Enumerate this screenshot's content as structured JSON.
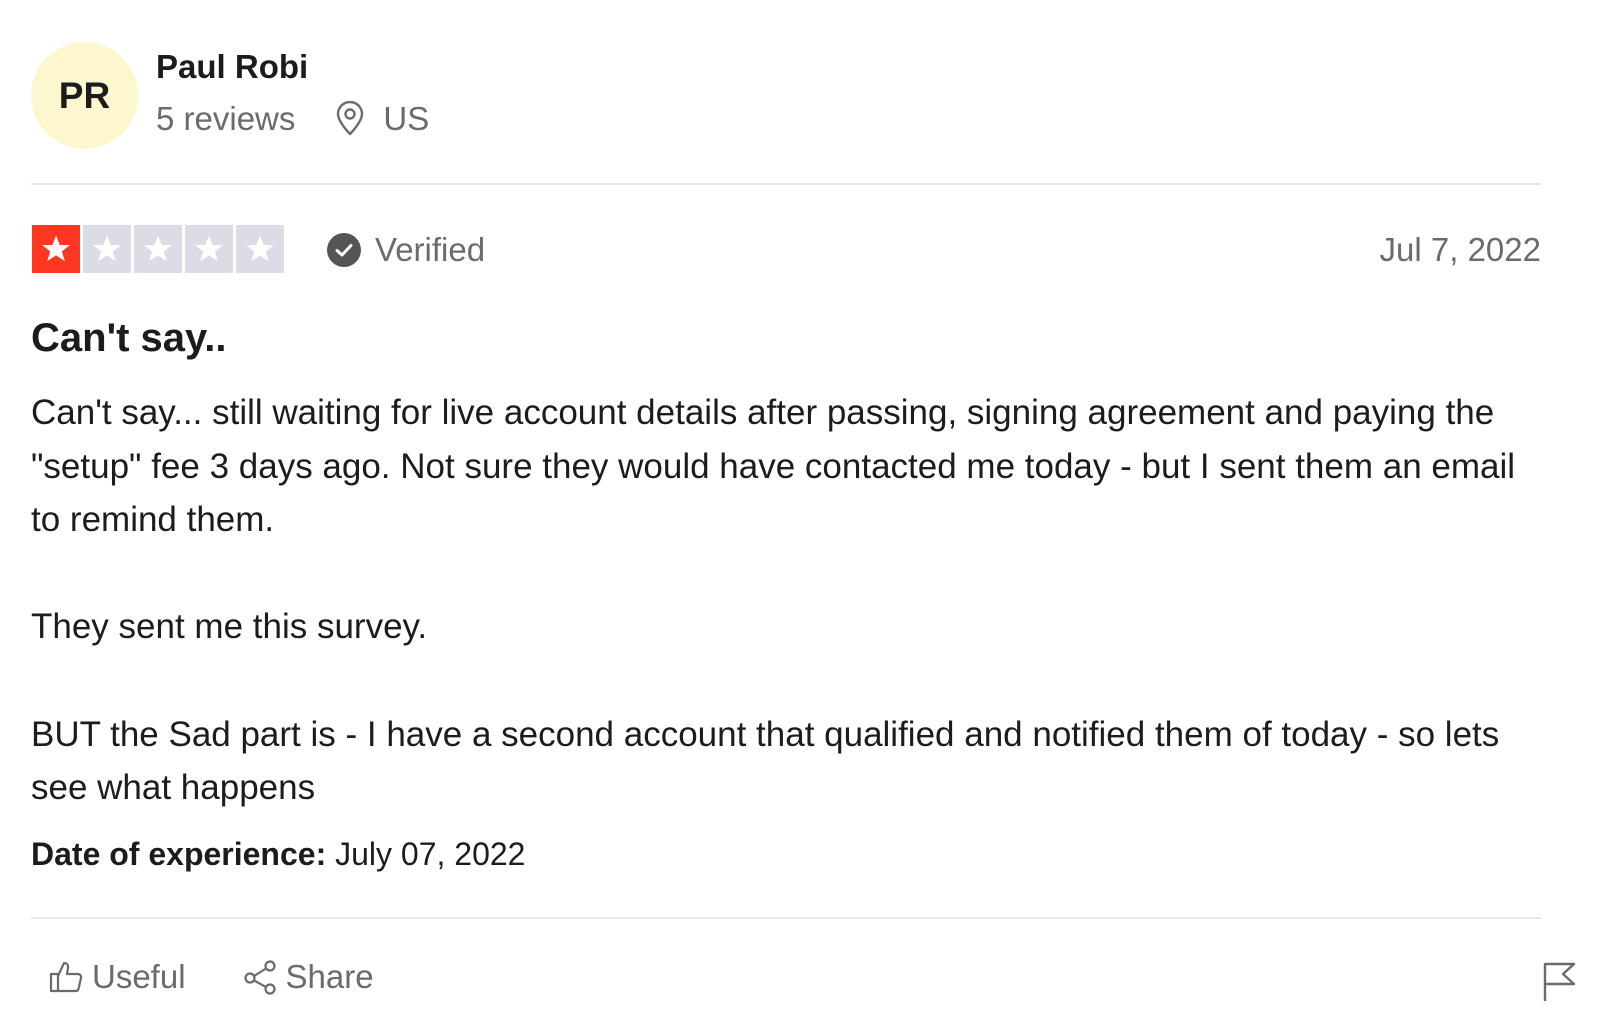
{
  "user": {
    "initials": "PR",
    "avatar_color": "#fcf7cf",
    "name": "Paul Robi",
    "reviews_count": "5 reviews",
    "location": "US",
    "location_icon": "map-pin-icon"
  },
  "review": {
    "rating": 1,
    "rating_max": 5,
    "rating_color": "#ff3722",
    "empty_star_color": "#dcdce6",
    "verified_label": "Verified",
    "date": "Jul 7, 2022",
    "title": "Can't say..",
    "body": [
      "Can't say... still waiting for live account details after passing, signing agreement and paying the \"setup\" fee 3 days ago. Not sure they would have contacted me today - but I sent them an email to remind them.",
      "They sent me this survey.",
      "BUT the Sad part is - I have a second account that qualified and notified them of today - so lets see what happens"
    ],
    "experience_label": "Date of experience:",
    "experience_date": "July 07, 2022"
  },
  "actions": {
    "useful_label": "Useful",
    "share_label": "Share"
  }
}
